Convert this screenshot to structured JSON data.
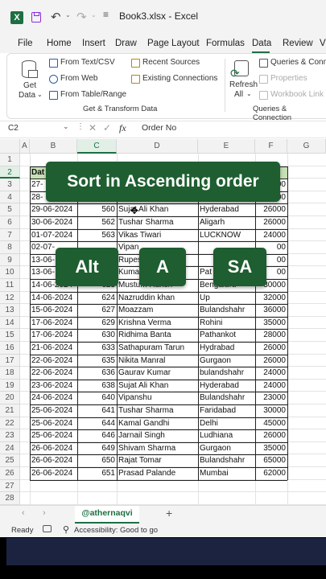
{
  "titlebar": {
    "app_icon": "excel-icon",
    "filename": "Book3.xlsx - Excel"
  },
  "menu": [
    "File",
    "Home",
    "Insert",
    "Draw",
    "Page Layout",
    "Formulas",
    "Data",
    "Review",
    "View"
  ],
  "menu_active": "Data",
  "ribbon": {
    "get_data": "Get",
    "get_data2": "Data",
    "from_text_csv": "From Text/CSV",
    "from_web": "From Web",
    "from_table_range": "From Table/Range",
    "recent_sources": "Recent Sources",
    "existing_connections": "Existing Connections",
    "group_get_transform": "Get & Transform Data",
    "refresh": "Refresh",
    "refresh_all": "All",
    "queries_conn": "Queries & Conn",
    "properties": "Properties",
    "workbook_links": "Workbook Link",
    "group_queries": "Queries & Connection"
  },
  "formula_bar": {
    "cell_ref": "C2",
    "fx": "fx",
    "content": "Order No"
  },
  "columns": [
    "A",
    "B",
    "C",
    "D",
    "E",
    "F",
    "G"
  ],
  "rows": [
    "1",
    "2",
    "3",
    "4",
    "5",
    "6",
    "7",
    "8",
    "9",
    "10",
    "11",
    "12",
    "13",
    "14",
    "15",
    "16",
    "17",
    "18",
    "19",
    "20",
    "21",
    "22",
    "23",
    "24",
    "25",
    "26",
    "27",
    "28"
  ],
  "table": {
    "header_b": "Dat",
    "rows": [
      {
        "date": "27-",
        "order": "",
        "name": "",
        "city": "",
        "amount": "00"
      },
      {
        "date": "28-",
        "order": "",
        "name": "",
        "city": "",
        "amount": "00"
      },
      {
        "date": "29-06-2024",
        "order": "560",
        "name": "Sujat Ali Khan",
        "city": "Hyderabad",
        "amount": "26000"
      },
      {
        "date": "30-06-2024",
        "order": "562",
        "name": "Tushar Sharma",
        "city": "Aligarh",
        "amount": "26000"
      },
      {
        "date": "01-07-2024",
        "order": "563",
        "name": "Vikas Tiwari",
        "city": "LUCKNOW",
        "amount": "24000"
      },
      {
        "date": "02-07-",
        "order": "",
        "name": "Vipan",
        "city": "",
        "amount": "00"
      },
      {
        "date": "13-06-",
        "order": "",
        "name": "Rupes",
        "city": "",
        "amount": "00"
      },
      {
        "date": "13-06-",
        "order": "",
        "name": "Kuma",
        "city": "Pat",
        "amount": "00"
      },
      {
        "date": "14-06-2024",
        "order": "623",
        "name": "Mustum Harish",
        "city": "Bengaluru",
        "amount": "30000"
      },
      {
        "date": "14-06-2024",
        "order": "624",
        "name": "Nazruddin khan",
        "city": "Up",
        "amount": "32000"
      },
      {
        "date": "15-06-2024",
        "order": "627",
        "name": "Moazzam",
        "city": "Bulandshahr",
        "amount": "36000"
      },
      {
        "date": "17-06-2024",
        "order": "629",
        "name": "Krishna Verma",
        "city": "Rohini",
        "amount": "35000"
      },
      {
        "date": "17-06-2024",
        "order": "630",
        "name": "Ridhima Banta",
        "city": "Pathankot",
        "amount": "28000"
      },
      {
        "date": "21-06-2024",
        "order": "633",
        "name": "Sathapuram Tarun",
        "city": "Hydrabad",
        "amount": "26000"
      },
      {
        "date": "22-06-2024",
        "order": "635",
        "name": "Nikita Manral",
        "city": "Gurgaon",
        "amount": "26000"
      },
      {
        "date": "22-06-2024",
        "order": "636",
        "name": "Gaurav Kumar",
        "city": "bulandshahr",
        "amount": "24000"
      },
      {
        "date": "23-06-2024",
        "order": "638",
        "name": "Sujat Ali Khan",
        "city": "Hyderabad",
        "amount": "24000"
      },
      {
        "date": "24-06-2024",
        "order": "640",
        "name": "Vipanshu",
        "city": "Bulandshahr",
        "amount": "23000"
      },
      {
        "date": "25-06-2024",
        "order": "641",
        "name": "Tushar Sharma",
        "city": "Faridabad",
        "amount": "30000"
      },
      {
        "date": "25-06-2024",
        "order": "644",
        "name": "Kamal Gandhi",
        "city": "Delhi",
        "amount": "45000"
      },
      {
        "date": "25-06-2024",
        "order": "646",
        "name": "Jarnail Singh",
        "city": "Ludhiana",
        "amount": "26000"
      },
      {
        "date": "26-06-2024",
        "order": "649",
        "name": "Shivam Sharma",
        "city": "Gurgaon",
        "amount": "35000"
      },
      {
        "date": "26-06-2024",
        "order": "650",
        "name": "Rajat Tomar",
        "city": "Bulandshahr",
        "amount": "65000"
      },
      {
        "date": "26-06-2024",
        "order": "651",
        "name": "Prasad Palande",
        "city": "Mumbai",
        "amount": "62000"
      }
    ]
  },
  "overlays": {
    "title": "Sort in Ascending order",
    "key1": "Alt",
    "key2": "A",
    "key3": "SA"
  },
  "sheet_tab": "@athernaqvi",
  "add_sheet": "+",
  "status": {
    "ready": "Ready",
    "accessibility": "Accessibility: Good to go"
  }
}
